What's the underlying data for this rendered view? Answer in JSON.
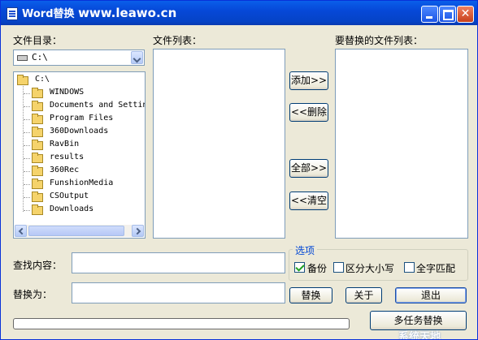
{
  "window": {
    "title_app": "Word替换",
    "title_url": "www.leawo.cn",
    "min_icon": "minimize-icon",
    "max_icon": "maximize-icon",
    "close_icon": "close-icon",
    "close_glyph": "✕"
  },
  "dir_panel": {
    "label": "文件目录：",
    "drive_value": "C:\\",
    "tree_root": "C:\\",
    "folders": [
      "WINDOWS",
      "Documents and Settings",
      "Program Files",
      "360Downloads",
      "RavBin",
      "results",
      "360Rec",
      "FunshionMedia",
      "CSOutput",
      "Downloads"
    ]
  },
  "file_list": {
    "label": "文件列表："
  },
  "replace_list": {
    "label": "要替换的文件列表："
  },
  "buttons": {
    "add": "添加>>",
    "remove": "<<删除",
    "add_all": "全部>>",
    "clear": "<<清空",
    "replace": "替换",
    "about": "关于",
    "exit": "退出",
    "multitask": "多任务替换"
  },
  "find": {
    "label": "查找内容：",
    "value": ""
  },
  "replace_with": {
    "label": "替换为：",
    "value": ""
  },
  "options": {
    "title": "选项",
    "backup": {
      "label": "备份",
      "checked": true
    },
    "match_case": {
      "label": "区分大小写",
      "checked": false
    },
    "whole_word": {
      "label": "全字匹配",
      "checked": false
    }
  },
  "progress": {
    "value": 0
  },
  "watermark": "系统天地",
  "colors": {
    "title_bar": "#0a5fea",
    "window_bg": "#ece9d8",
    "group_title": "#0046d5"
  }
}
